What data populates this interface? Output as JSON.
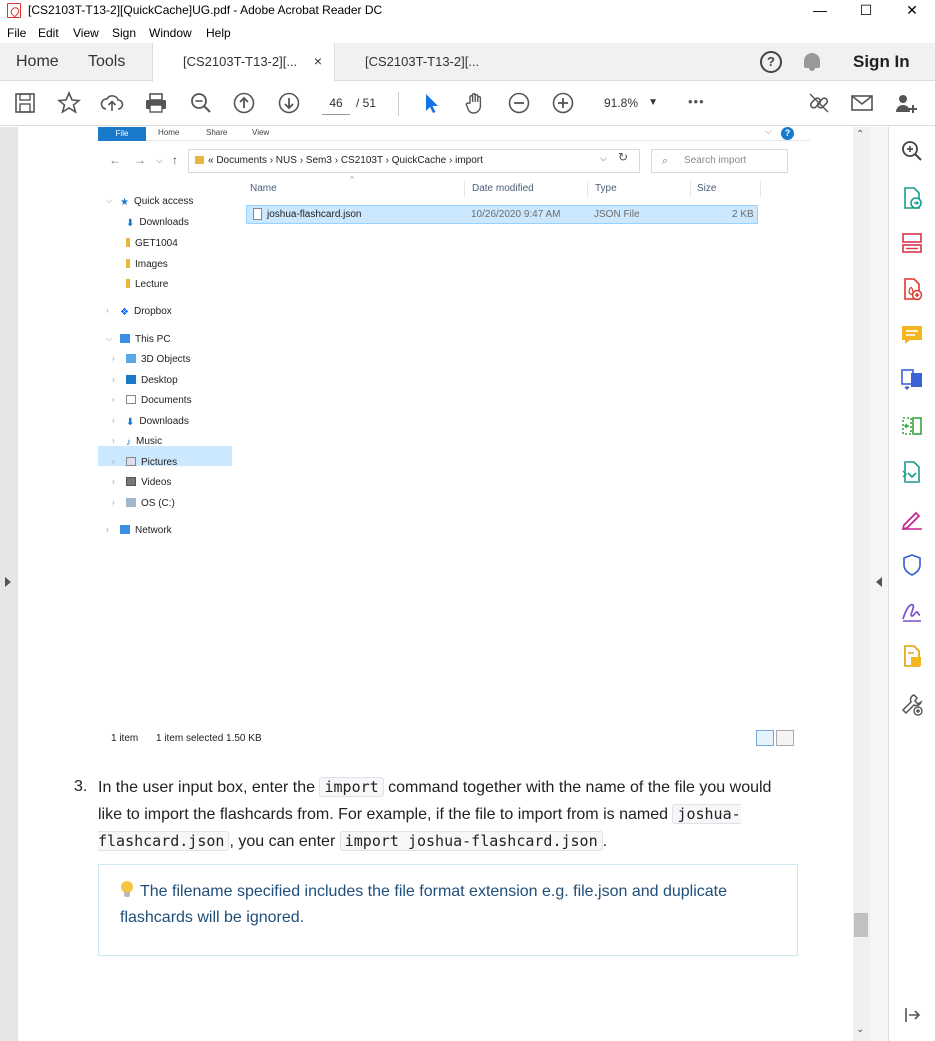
{
  "window": {
    "title": "[CS2103T-T13-2][QuickCache]UG.pdf - Adobe Acrobat Reader DC",
    "minimize": "—",
    "maximize": "☐",
    "close": "✕"
  },
  "menu": [
    "File",
    "Edit",
    "View",
    "Sign",
    "Window",
    "Help"
  ],
  "tabs": {
    "home": "Home",
    "tools": "Tools",
    "doc1": "[CS2103T-T13-2][...",
    "doc1_close": "×",
    "doc2": "[CS2103T-T13-2][...",
    "sign_in": "Sign In",
    "help": "?"
  },
  "toolbar": {
    "page_current": "46",
    "page_total": "/  51",
    "zoom": "91.8%",
    "more": "•••"
  },
  "explorer": {
    "ribbon_tabs": [
      "File",
      "Home",
      "Share",
      "View"
    ],
    "address": "«  Documents  ›  NUS  ›  Sem3  ›  CS2103T  ›  QuickCache  ›  import",
    "search_placeholder": "Search import",
    "nav": {
      "quick_access": "Quick access",
      "downloads": "Downloads",
      "get1004": "GET1004",
      "images": "Images",
      "lecture": "Lecture",
      "dropbox": "Dropbox",
      "this_pc": "This PC",
      "objects3d": "3D Objects",
      "desktop": "Desktop",
      "documents": "Documents",
      "downloads2": "Downloads",
      "music": "Music",
      "pictures": "Pictures",
      "videos": "Videos",
      "os": "OS (C:)",
      "network": "Network"
    },
    "columns": {
      "name": "Name",
      "date": "Date modified",
      "type": "Type",
      "size": "Size"
    },
    "file": {
      "name": "joshua-flashcard.json",
      "date": "10/26/2020 9:47 AM",
      "type": "JSON File",
      "size": "2 KB"
    },
    "status": {
      "items": "1 item",
      "selected": "1 item selected  1.50 KB"
    }
  },
  "doc": {
    "step_number": "3.",
    "step_text_1": "In the user input box, enter the ",
    "code_import": "import",
    "step_text_2": " command together with the name of the file you would like to import the flashcards from. For example, if the file to import from is named ",
    "code_file": "joshua-flashcard.json",
    "step_text_3": ", you can enter ",
    "code_cmd": "import joshua-flashcard.json",
    "step_text_4": ".",
    "tip": "The filename specified includes the file format extension e.g. file.json and duplicate flashcards will be ignored."
  },
  "colors": {
    "explorer_selection": "#cce8ff",
    "explorer_file_tab": "#1979ca",
    "tip_text": "#1f4e79",
    "tip_border": "#cfe9f3"
  }
}
